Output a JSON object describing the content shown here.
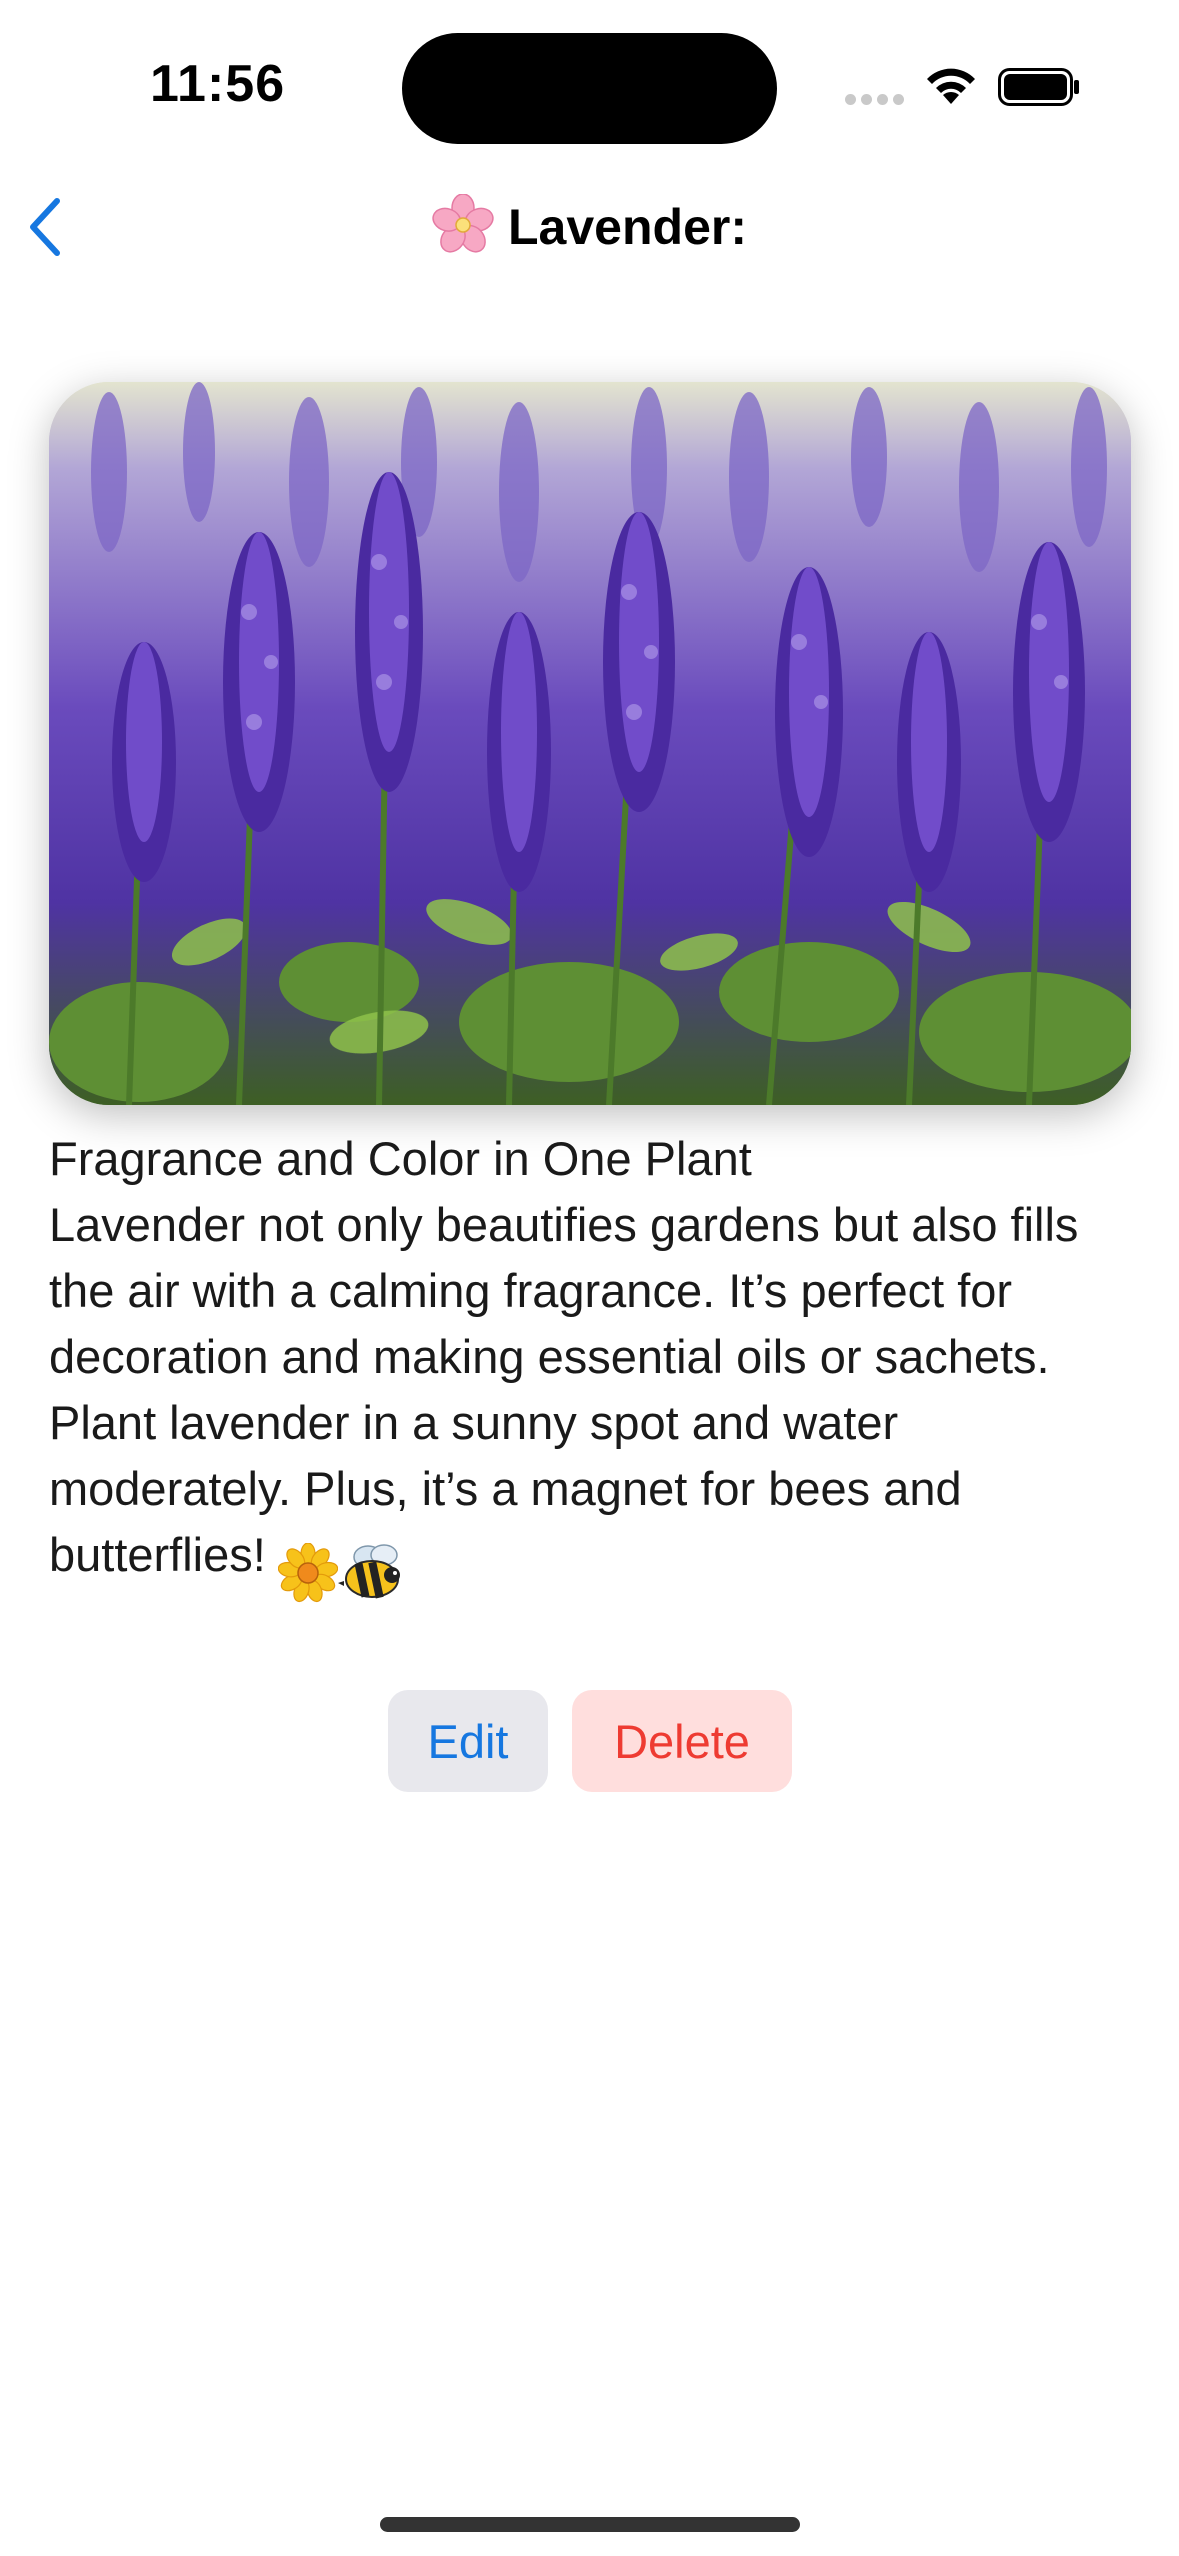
{
  "status_bar": {
    "time": "11:56"
  },
  "nav": {
    "title": "Lavender:",
    "title_icon": "cherry-blossom-icon",
    "back_icon": "chevron-left-icon"
  },
  "hero_image": {
    "subject": "lavender-field-photo"
  },
  "description": {
    "heading": "Fragrance and Color in One Plant",
    "body": "Lavender not only beautifies gardens but also fills the air with a calming fragrance. It’s perfect for decoration and making essential oils or sachets. Plant lavender in a sunny spot and water moderately. Plus, it’s a magnet for bees and butterflies!",
    "trailing_icons": [
      "sunflower-icon",
      "bee-icon"
    ]
  },
  "actions": {
    "edit_label": "Edit",
    "delete_label": "Delete"
  },
  "colors": {
    "accent": "#1677e0",
    "destructive": "#ee3b32",
    "edit_bg": "#e8e8ed",
    "delete_bg": "#ffdedd"
  }
}
